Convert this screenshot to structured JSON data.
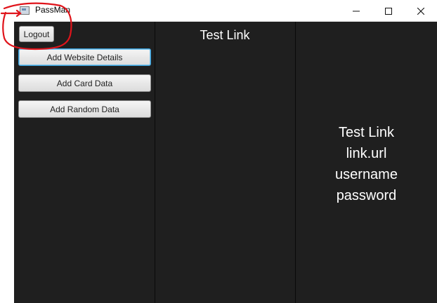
{
  "window": {
    "title": "PassMan",
    "icon": "app-window-icon",
    "controls": [
      "minimize-icon",
      "maximize-icon",
      "close-icon"
    ]
  },
  "sidebar": {
    "logout_label": "Logout",
    "add_website_label": "Add Website Details",
    "add_card_label": "Add Card Data",
    "add_random_label": "Add Random Data"
  },
  "list": {
    "items": [
      {
        "label": "Test Link"
      }
    ]
  },
  "details": {
    "name": "Test Link",
    "url": "link.url",
    "username": "username",
    "password": "password"
  },
  "colors": {
    "app_background": "#1f1f1f",
    "text": "#ffffff",
    "annotation": "#e0141b",
    "focus_border": "#3a9fd8"
  }
}
